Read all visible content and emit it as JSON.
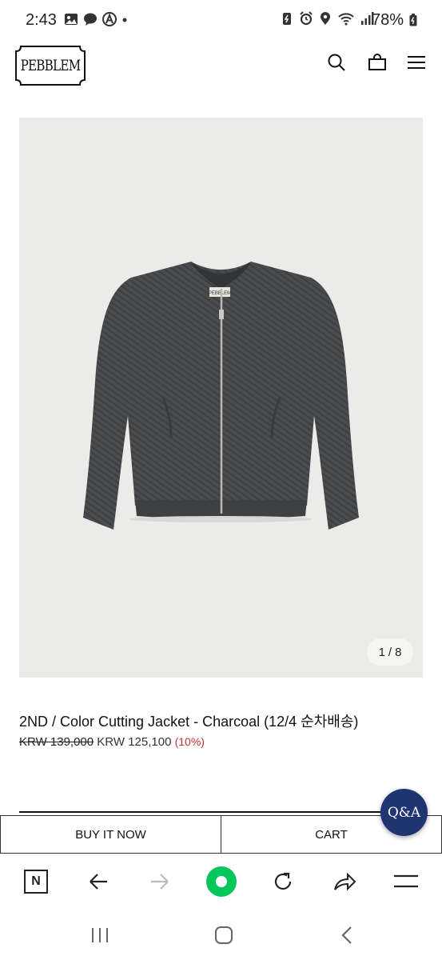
{
  "status_bar": {
    "time": "2:43",
    "battery": "78%",
    "left_icons": [
      "gallery-icon",
      "talk-icon",
      "a-icon",
      "dot-icon"
    ],
    "right_icons": [
      "battery-saver-icon",
      "alarm-icon",
      "location-icon",
      "wifi-icon",
      "signal-icon",
      "battery-icon"
    ]
  },
  "header": {
    "logo": "PEBBLEM",
    "icons": [
      "search-icon",
      "bag-icon",
      "menu-icon"
    ]
  },
  "product": {
    "image_alt": "Charcoal bomber jacket with zipper",
    "jacket_label": "PEBBLEM",
    "image_index": "1",
    "image_separator": "/",
    "image_total": "8",
    "title": "2ND / Color Cutting Jacket - Charcoal (12/4 순차배송)",
    "original_price": "KRW 139,000",
    "sale_price": "KRW 125,100",
    "discount": "(10%)"
  },
  "actions": {
    "buy_now": "BUY IT NOW",
    "cart": "CART",
    "qa": "Q&A"
  },
  "browser_toolbar": {
    "items": [
      "naver-icon",
      "back-icon",
      "forward-icon",
      "green-dot-icon",
      "refresh-icon",
      "share-icon",
      "menu-icon"
    ],
    "naver_letter": "N"
  },
  "colors": {
    "accent_qa": "#1f3572",
    "discount": "#c0352e",
    "naver_green": "#03c75a",
    "image_bg": "#ebebea"
  }
}
